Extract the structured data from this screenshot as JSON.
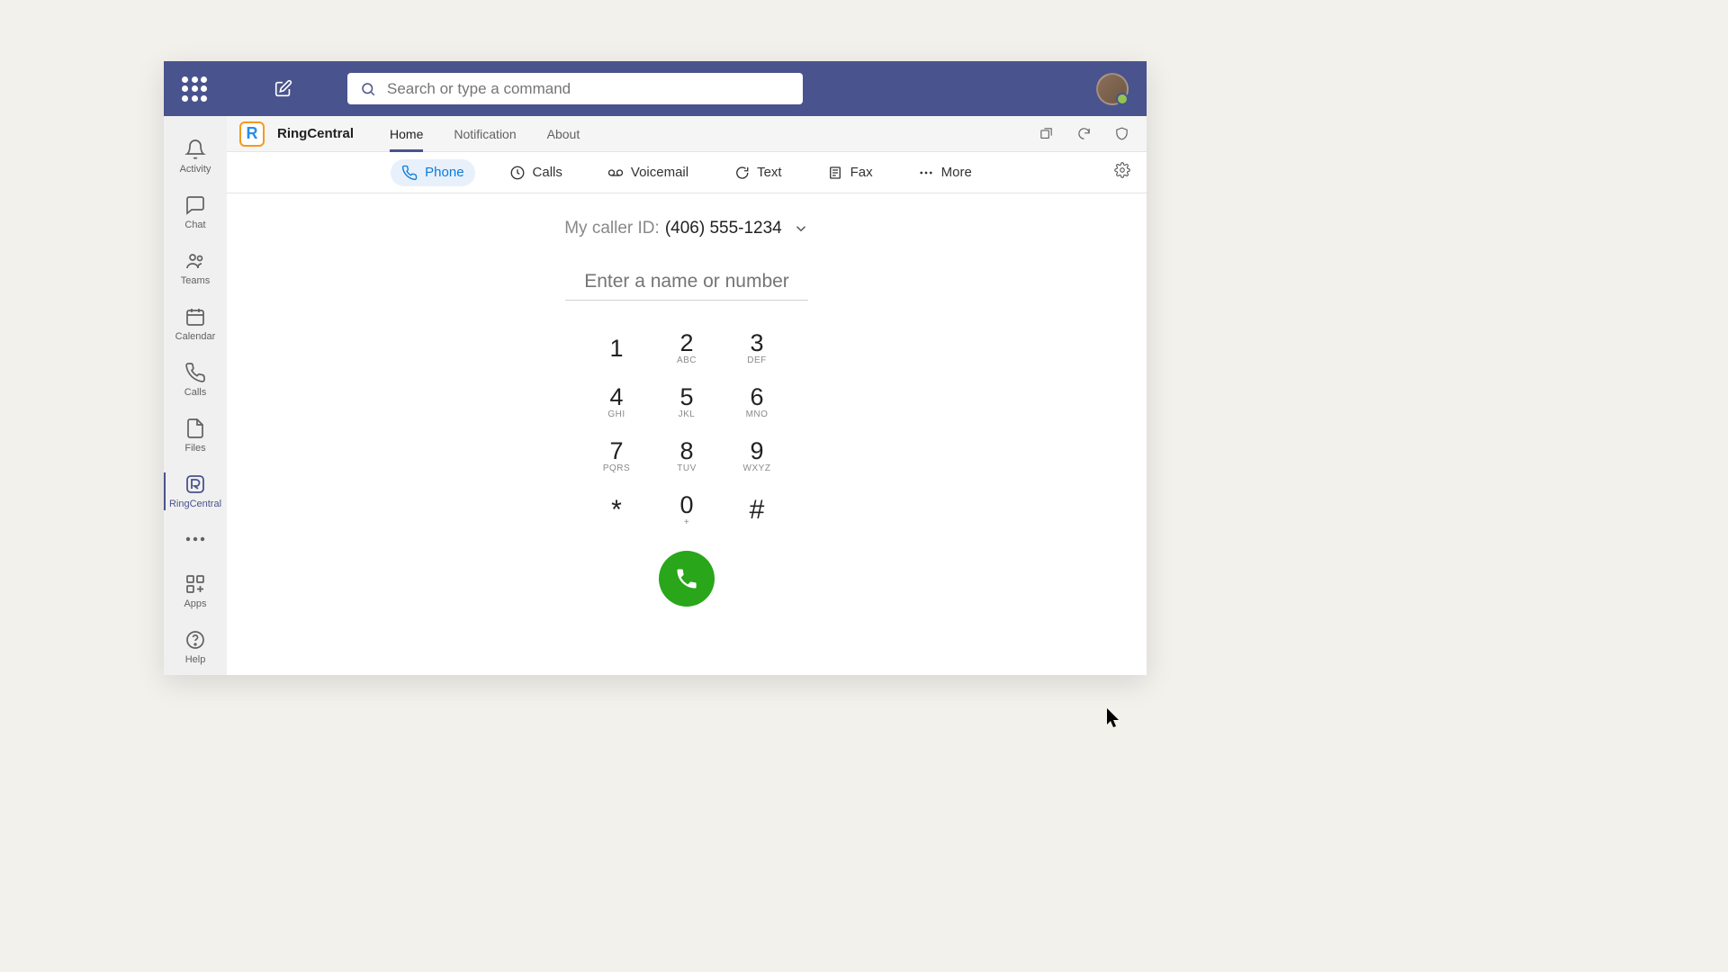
{
  "header": {
    "search_placeholder": "Search or type a command"
  },
  "sidebar": {
    "items": [
      {
        "label": "Activity"
      },
      {
        "label": "Chat"
      },
      {
        "label": "Teams"
      },
      {
        "label": "Calendar"
      },
      {
        "label": "Calls"
      },
      {
        "label": "Files"
      },
      {
        "label": "RingCentral"
      }
    ],
    "apps_label": "Apps",
    "help_label": "Help"
  },
  "app_header": {
    "app_name": "RingCentral",
    "tabs": [
      {
        "label": "Home"
      },
      {
        "label": "Notification"
      },
      {
        "label": "About"
      }
    ]
  },
  "toolbar": {
    "items": [
      {
        "label": "Phone"
      },
      {
        "label": "Calls"
      },
      {
        "label": "Voicemail"
      },
      {
        "label": "Text"
      },
      {
        "label": "Fax"
      },
      {
        "label": "More"
      }
    ]
  },
  "dialer": {
    "caller_id_label": "My caller ID:",
    "caller_id_value": "(406) 555-1234",
    "input_placeholder": "Enter a name or number",
    "keys": [
      {
        "d": "1",
        "l": ""
      },
      {
        "d": "2",
        "l": "ABC"
      },
      {
        "d": "3",
        "l": "DEF"
      },
      {
        "d": "4",
        "l": "GHI"
      },
      {
        "d": "5",
        "l": "JKL"
      },
      {
        "d": "6",
        "l": "MNO"
      },
      {
        "d": "7",
        "l": "PQRS"
      },
      {
        "d": "8",
        "l": "TUV"
      },
      {
        "d": "9",
        "l": "WXYZ"
      },
      {
        "d": "*",
        "l": ""
      },
      {
        "d": "0",
        "l": "+"
      },
      {
        "d": "#",
        "l": ""
      }
    ]
  },
  "colors": {
    "primary": "#49538d",
    "accent": "#0b7dda",
    "call_green": "#29a61a",
    "logo_orange": "#f49a1e"
  }
}
